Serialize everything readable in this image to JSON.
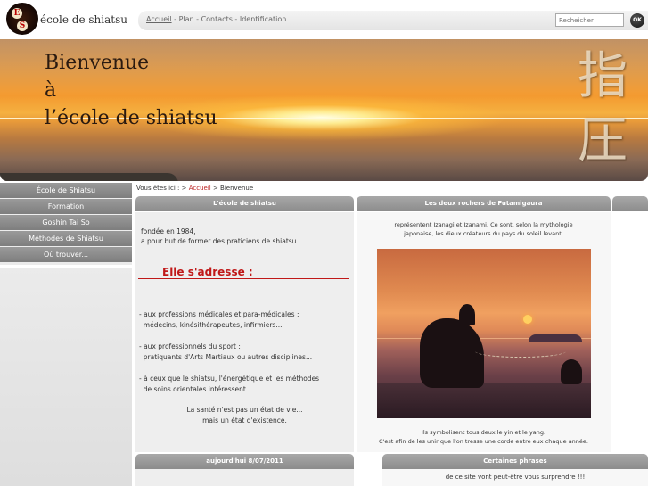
{
  "header": {
    "logo_letters": [
      "E",
      "S"
    ],
    "logo_text": "école de shiatsu"
  },
  "topnav": {
    "links": [
      "Accueil",
      "Plan",
      "Contacts",
      "Identification"
    ],
    "separator": " - ",
    "search_placeholder": "Recheicher",
    "search_button": "OK"
  },
  "banner": {
    "title_lines": [
      "Bienvenue",
      "à",
      "l’école de shiatsu"
    ],
    "kanji": "指圧"
  },
  "sidebar": {
    "items": [
      {
        "label": "École de Shiatsu"
      },
      {
        "label": "Formation"
      },
      {
        "label": "Goshin Tai So"
      },
      {
        "label": "Méthodes de Shiatsu"
      },
      {
        "label": "Où trouver..."
      }
    ]
  },
  "breadcrumb": {
    "prefix": "Vous êtes ici : > ",
    "link": "Accueil",
    "current": " > Bienvenue"
  },
  "panel1": {
    "title": "L'école de shiatsu",
    "founded": "fondée en 1984,",
    "goal": "a pour but de former des praticiens de shiatsu.",
    "heading": "Elle s'adresse :",
    "audience1_a": "- aux professions médicales et para-médicales :",
    "audience1_b": "  médecins, kinésithérapeutes, infirmiers...",
    "audience2_a": "- aux professionnels du sport :",
    "audience2_b": "  pratiquants d'Arts Martiaux ou autres disciplines...",
    "audience3_a": "- à ceux que le shiatsu, l'énergétique et les méthodes",
    "audience3_b": "  de soins orientales intéressent.",
    "quote_a": "La santé n'est pas un état de vie...",
    "quote_b": "mais un état d'existence."
  },
  "panel2": {
    "title": "Les deux rochers de Futamigaura",
    "intro_a": "représentent Izanagi et Izanami. Ce sont, selon la mythologie",
    "intro_b": "japonaise, les dieux créateurs du pays du soleil levant.",
    "caption_a": "Ils symbolisent tous deux le yin et le yang.",
    "caption_b": "C'est afin de les unir que l'on tresse une corde entre eux chaque année."
  },
  "panel3": {
    "title": "aujourd'hui  8/07/2011"
  },
  "panel4": {
    "title": "Certaines phrases",
    "text": "de ce site vont peut-être vous surprendre !!!"
  },
  "colors": {
    "accent_red": "#c01818",
    "menu_gray": "#8c8c8c",
    "panel_bg": "#eeeeee"
  }
}
